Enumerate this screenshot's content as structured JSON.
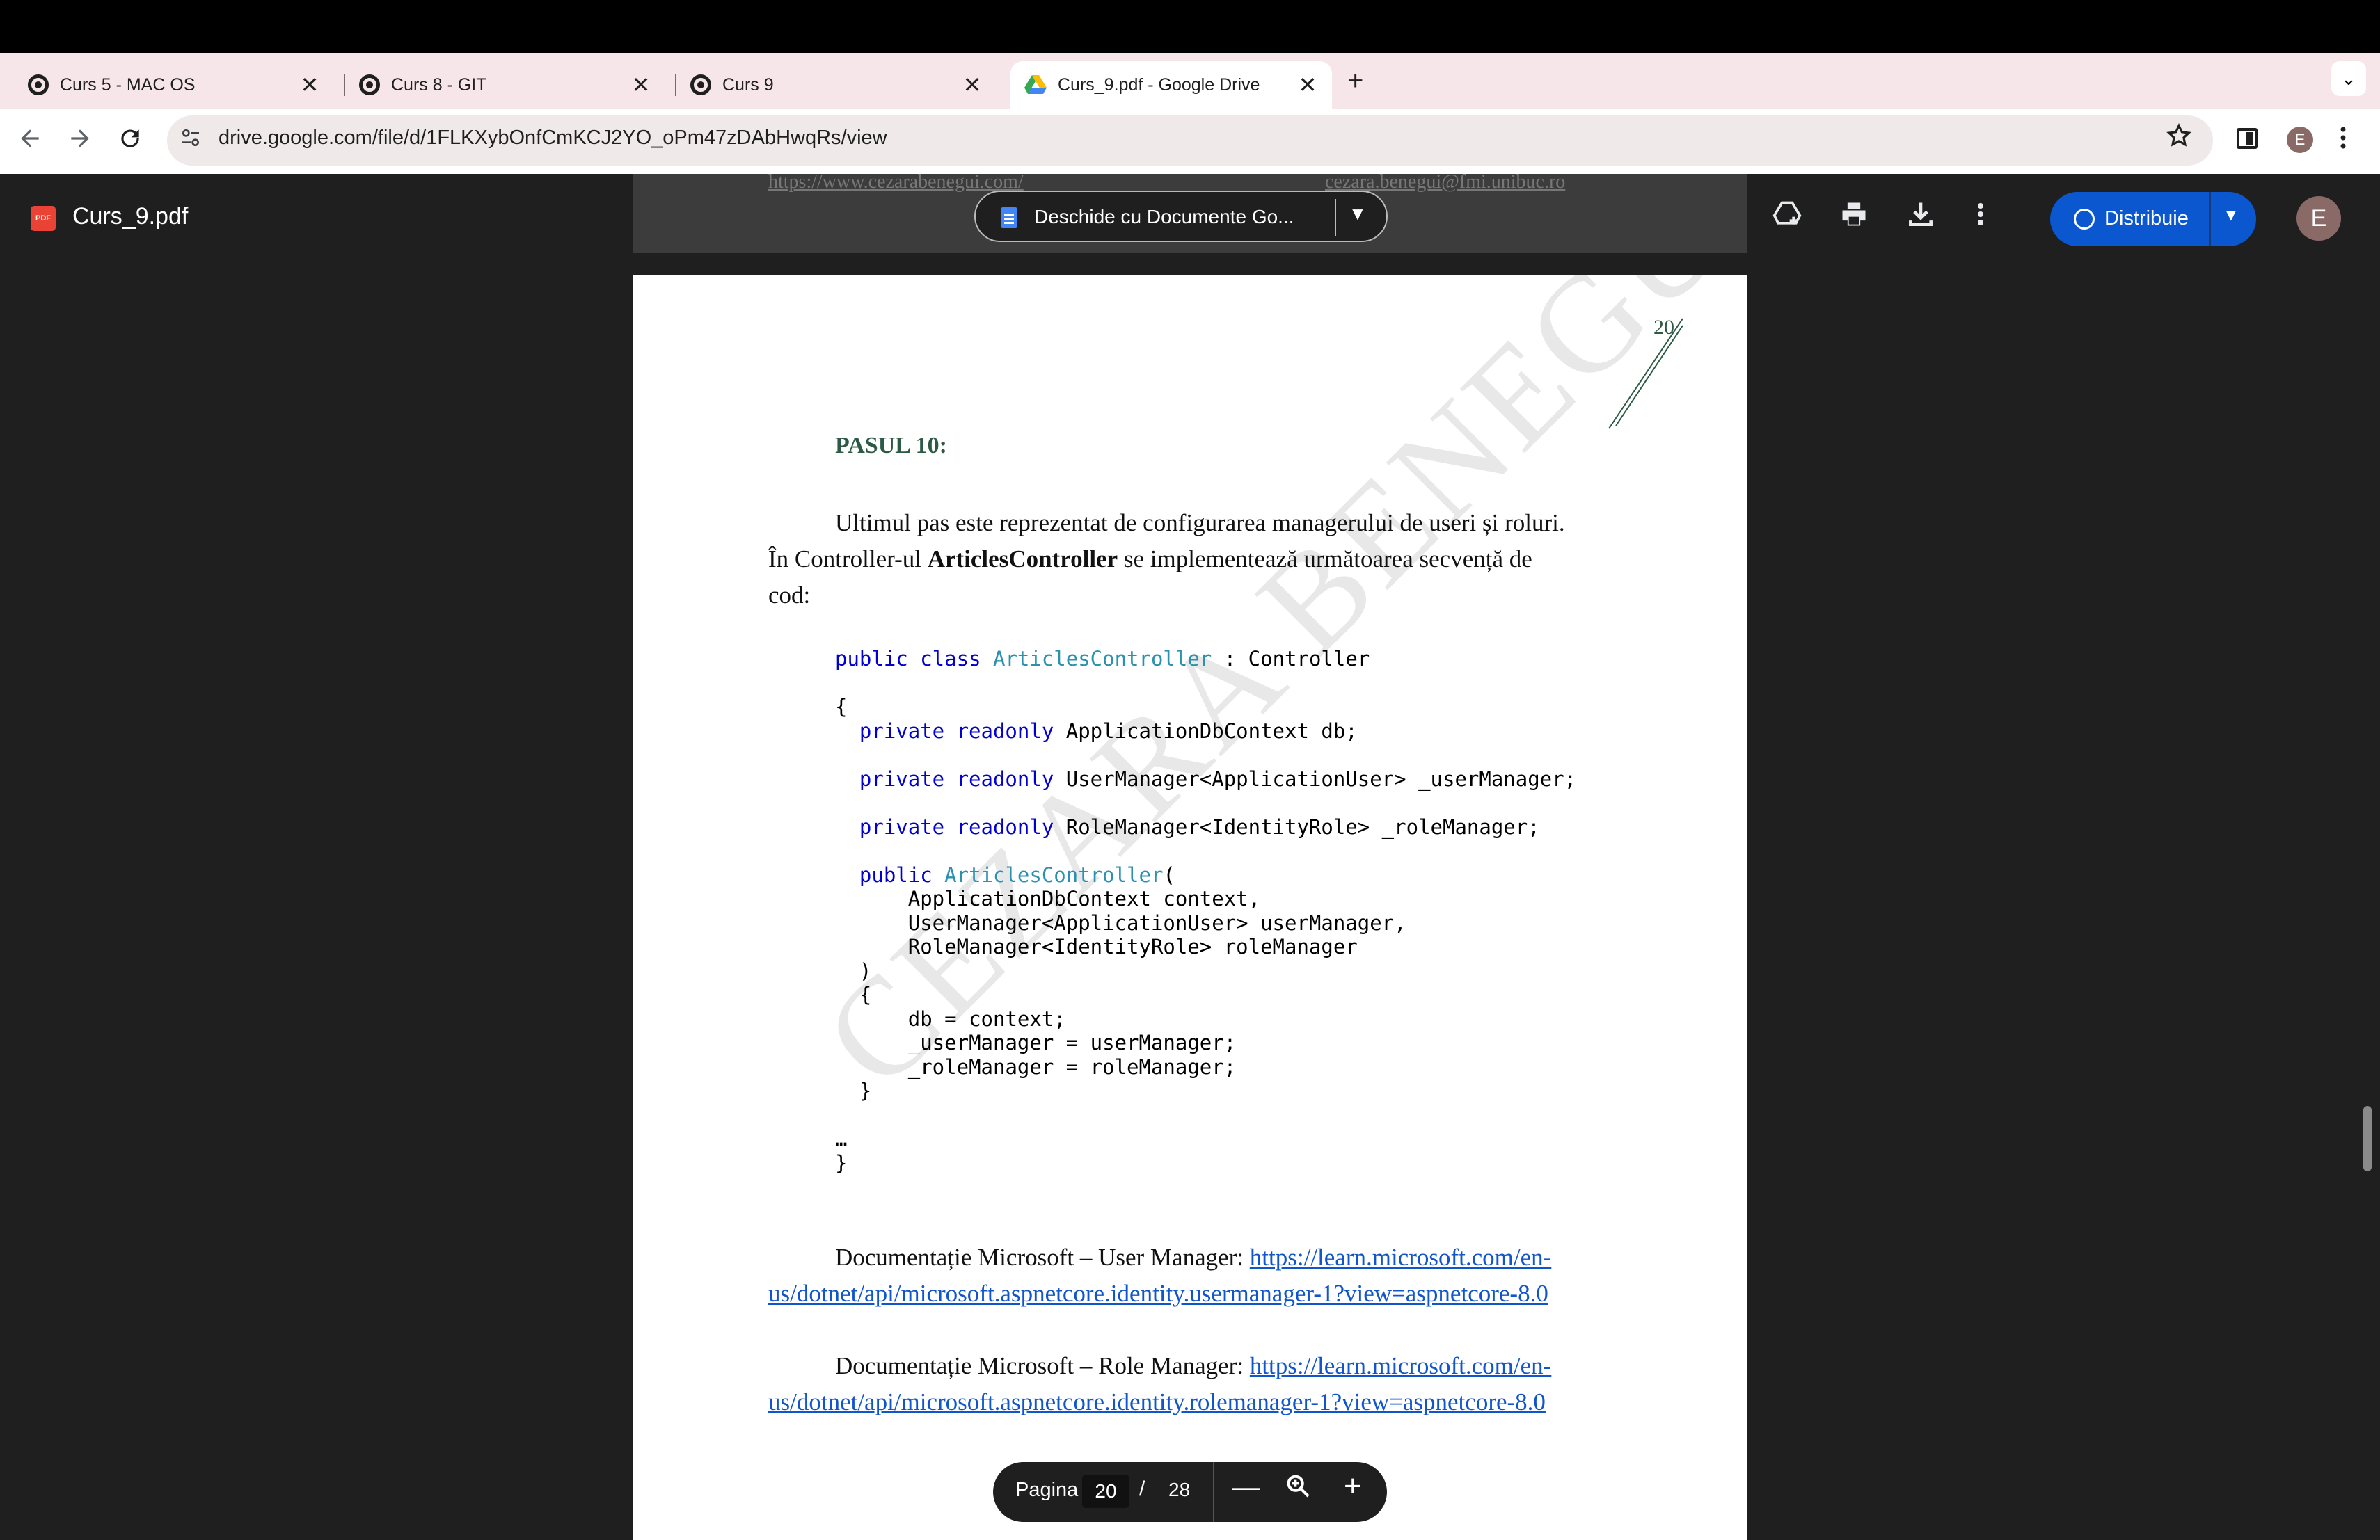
{
  "browser": {
    "tabs": [
      {
        "title": "Curs 5 - MAC OS",
        "close": "✕"
      },
      {
        "title": "Curs 8 - GIT",
        "close": "✕"
      },
      {
        "title": "Curs 9",
        "close": "✕"
      },
      {
        "title": "Curs_9.pdf - Google Drive",
        "close": "✕"
      }
    ],
    "new_tab": "+",
    "tab_menu": "⌄",
    "url": "drive.google.com/file/d/1FLKXybOnfCmKCJ2YO_oPm47zDAbHwqRs/view",
    "profile_initial": "E",
    "icons": {
      "back": "arrow-left-icon",
      "forward": "arrow-right-icon",
      "reload": "reload-icon",
      "star": "star-icon",
      "side_panel": "side-panel-icon",
      "menu": "kebab-menu-icon"
    }
  },
  "drive": {
    "file_name": "Curs_9.pdf",
    "pdf_badge": "PDF",
    "open_with": "Deschide cu Documente Go...",
    "share_label": "Distribuie",
    "avatar_initial": "E",
    "ghost_links": [
      "https://www.cezarabenegui.com/",
      "cezara.benegui@fmi.unibuc.ro"
    ],
    "icons": [
      "add-to-drive-icon",
      "print-icon",
      "download-icon",
      "more-icon"
    ]
  },
  "document": {
    "page_number": "20",
    "step_title": "PASUL 10:",
    "paragraph": {
      "part1": "Ultimul pas este reprezentat de configurarea managerului de useri și roluri. În Controller-ul ",
      "bold": "ArticlesController",
      "part2": " se implementează următoarea secvență de cod:"
    },
    "code": {
      "l1_kw": "public class",
      "l1_type": "ArticlesController",
      "l1_rest": " : Controller",
      "l2": "{",
      "l3_kw": "private readonly",
      "l3_rest": " ApplicationDbContext db;",
      "l4_kw": "private readonly",
      "l4_rest": " UserManager<ApplicationUser> _userManager;",
      "l5_kw": "private readonly",
      "l5_rest": " RoleManager<IdentityRole> _roleManager;",
      "l6_kw": "public",
      "l6_type": "ArticlesController",
      "l6_rest": "(",
      "l7": "ApplicationDbContext context,",
      "l8": "UserManager<ApplicationUser> userManager,",
      "l9": "RoleManager<IdentityRole> roleManager",
      "l10": ")",
      "l11": "{",
      "l12": "db = context;",
      "l13": "_userManager = userManager;",
      "l14": "_roleManager = roleManager;",
      "l15": "}",
      "l16": "…",
      "l17": "}"
    },
    "doc1_label": "Documentație Microsoft – User Manager: ",
    "doc1_link": "https://learn.microsoft.com/en-us/dotnet/api/microsoft.aspnetcore.identity.usermanager-1?view=aspnetcore-8.0",
    "doc2_label": "Documentație Microsoft – Role Manager: ",
    "doc2_link": "https://learn.microsoft.com/en-us/dotnet/api/microsoft.aspnetcore.identity.rolemanager-1?view=aspnetcore-8.0",
    "watermark": "CEZARA BENEGUI"
  },
  "page_controls": {
    "label": "Pagina",
    "current": "20",
    "separator": "/",
    "total": "28",
    "zoom_out": "—",
    "zoom_icon": "🔍",
    "zoom_in": "+"
  }
}
